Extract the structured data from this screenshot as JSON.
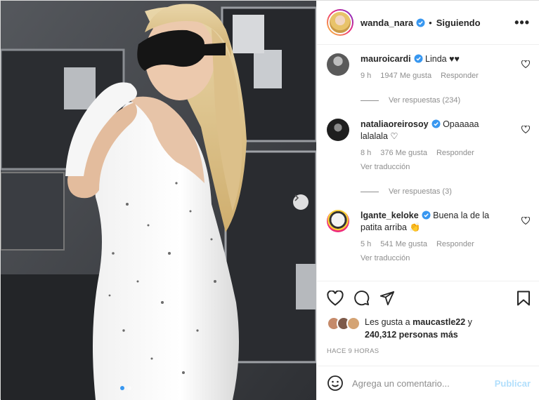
{
  "header": {
    "username": "wanda_nara",
    "separator": "•",
    "follow_label": "Siguiendo",
    "more_label": "•••"
  },
  "comments": [
    {
      "username": "mauroicardi",
      "text": "Linda ♥♥",
      "time": "9 h",
      "likes": "1947 Me gusta",
      "reply_label": "Responder",
      "avatar_color": "#5a5a5a",
      "view_replies": "Ver respuestas (234)"
    },
    {
      "username": "nataliaoreirosoy",
      "text": "Opaaaaa lalalala ♡",
      "time": "8 h",
      "likes": "376 Me gusta",
      "reply_label": "Responder",
      "translate": "Ver traducción",
      "avatar_color": "#2a2a2a",
      "view_replies": "Ver respuestas (3)"
    },
    {
      "username": "lgante_keloke",
      "text": "Buena la de la patita arriba 👏",
      "time": "5 h",
      "likes": "541 Me gusta",
      "reply_label": "Responder",
      "translate": "Ver traducción",
      "avatar_color": "#d9d9d9"
    }
  ],
  "likes": {
    "prefix": "Les gusta a",
    "user": "maucastle22",
    "suffix_a": "y",
    "count": "240,312 personas más"
  },
  "timestamp": "HACE 9 HORAS",
  "add_comment": {
    "placeholder": "Agrega un comentario...",
    "publish_label": "Publicar"
  },
  "colors": {
    "verified": "#3897f0",
    "publish_disabled": "#b2dffc",
    "muted": "#8e8e8e"
  }
}
